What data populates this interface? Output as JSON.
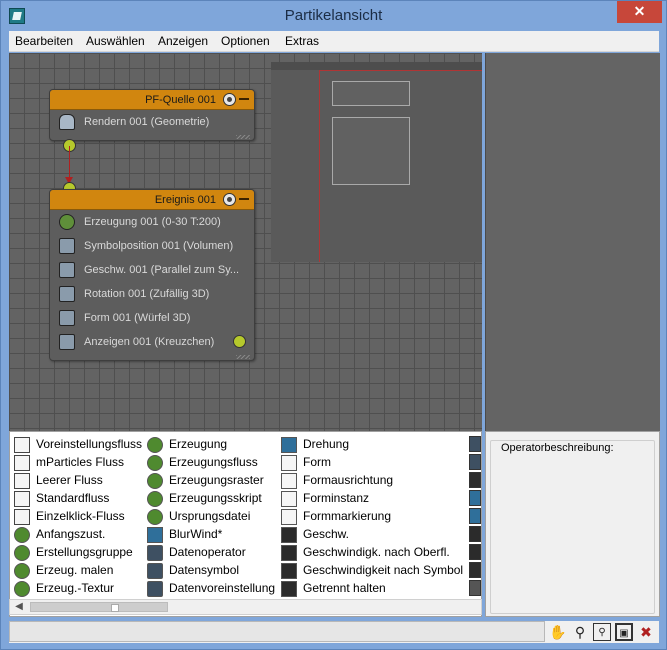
{
  "window": {
    "title": "Partikelansicht",
    "close_label": "✕"
  },
  "menu": {
    "items": [
      "Bearbeiten",
      "Auswählen",
      "Anzeigen",
      "Optionen",
      "Extras"
    ]
  },
  "graph": {
    "source_node": {
      "title": "PF-Quelle 001",
      "operators": [
        {
          "label": "Rendern 001 (Geometrie)",
          "icon": "teapot-icon"
        }
      ]
    },
    "event_node": {
      "title": "Ereignis 001",
      "operators": [
        {
          "label": "Erzeugung 001 (0-30 T:200)",
          "icon": "birth-icon"
        },
        {
          "label": "Symbolposition 001 (Volumen)",
          "icon": "position-icon"
        },
        {
          "label": "Geschw. 001 (Parallel zum Sy...",
          "icon": "speed-icon"
        },
        {
          "label": "Rotation 001 (Zufällig 3D)",
          "icon": "rotation-icon"
        },
        {
          "label": "Form 001 (Würfel 3D)",
          "icon": "shape-icon"
        },
        {
          "label": "Anzeigen 001 (Kreuzchen)",
          "icon": "display-icon"
        }
      ]
    }
  },
  "depot": {
    "columns": [
      [
        {
          "label": "Voreinstellungsfluss",
          "icon": "preset-flow-icon"
        },
        {
          "label": "mParticles Fluss",
          "icon": "mparticles-flow-icon"
        },
        {
          "label": "Leerer Fluss",
          "icon": "empty-flow-icon"
        },
        {
          "label": "Standardfluss",
          "icon": "standard-flow-icon"
        },
        {
          "label": "Einzelklick-Fluss",
          "icon": "one-click-flow-icon"
        },
        {
          "label": "Anfangszust.",
          "icon": "initial-state-icon"
        },
        {
          "label": "Erstellungsgruppe",
          "icon": "birth-group-icon"
        },
        {
          "label": "Erzeug. malen",
          "icon": "birth-paint-icon"
        },
        {
          "label": "Erzeug.-Textur",
          "icon": "birth-texture-icon"
        }
      ],
      [
        {
          "label": "Erzeugung",
          "icon": "birth-icon"
        },
        {
          "label": "Erzeugungsfluss",
          "icon": "birth-flow-icon"
        },
        {
          "label": "Erzeugungsraster",
          "icon": "birth-grid-icon"
        },
        {
          "label": "Erzeugungsskript",
          "icon": "birth-script-icon"
        },
        {
          "label": "Ursprungsdatei",
          "icon": "birth-file-icon"
        },
        {
          "label": "BlurWind*",
          "icon": "blurwind-icon"
        },
        {
          "label": "Datenoperator",
          "icon": "data-operator-icon"
        },
        {
          "label": "Datensymbol",
          "icon": "data-icon-icon"
        },
        {
          "label": "Datenvoreinstellung",
          "icon": "data-preset-icon"
        }
      ],
      [
        {
          "label": "Drehung",
          "icon": "spin-icon"
        },
        {
          "label": "Form",
          "icon": "shape-icon"
        },
        {
          "label": "Formausrichtung",
          "icon": "shape-facing-icon"
        },
        {
          "label": "Forminstanz",
          "icon": "shape-instance-icon"
        },
        {
          "label": "Formmarkierung",
          "icon": "shape-mark-icon"
        },
        {
          "label": "Geschw.",
          "icon": "speed-icon"
        },
        {
          "label": "Geschwindigk. nach Oberfl.",
          "icon": "speed-by-surface-icon"
        },
        {
          "label": "Geschwindigkeit nach Symbol",
          "icon": "speed-by-icon-icon"
        },
        {
          "label": "Getrennt halten",
          "icon": "keep-apart-icon"
        }
      ]
    ]
  },
  "description": {
    "label": "Operatorbeschreibung:"
  },
  "statusbar": {
    "tools": [
      "pan-hand-icon",
      "zoom-icon",
      "zoom-region-icon",
      "zoom-extents-icon",
      "no-zoom-icon"
    ]
  },
  "colors": {
    "node_header": "#d1860f",
    "wire": "#b02020",
    "output_dot": "#b6c92c",
    "close_button": "#c7473a"
  }
}
